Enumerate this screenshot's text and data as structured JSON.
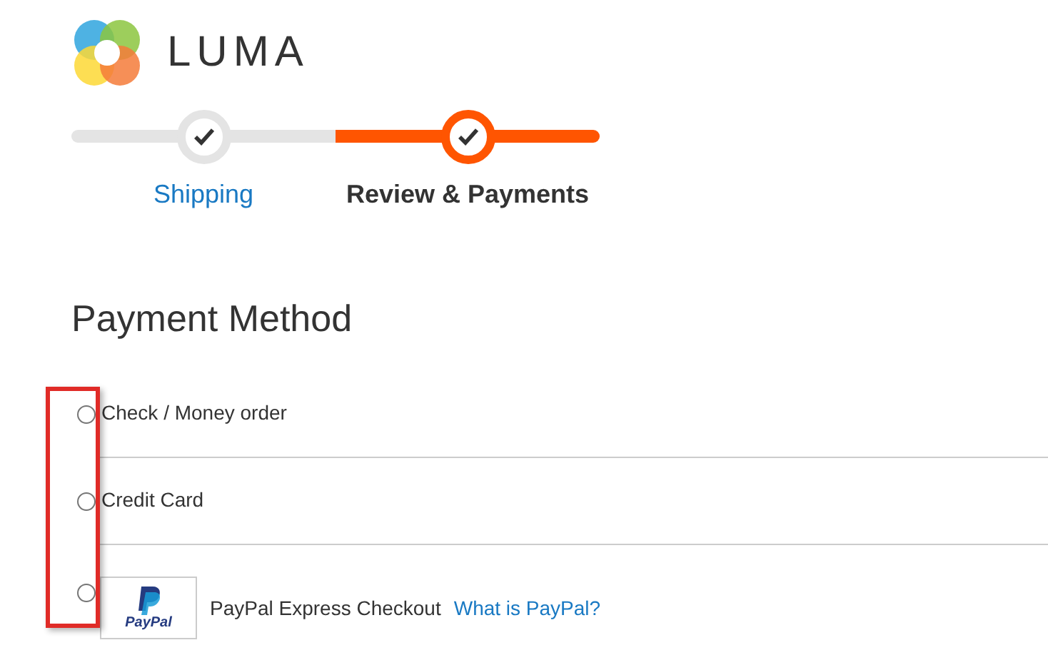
{
  "logo": {
    "text": "LUMA"
  },
  "steps": [
    {
      "label": "Shipping",
      "selected": false
    },
    {
      "label": "Review & Payments",
      "selected": true
    }
  ],
  "payment": {
    "title": "Payment Method",
    "methods": [
      {
        "kind": "plain",
        "label": "Check / Money order",
        "selected": false
      },
      {
        "kind": "plain",
        "label": "Credit Card",
        "selected": false
      },
      {
        "kind": "paypal",
        "logo_text": "PayPal",
        "label": "PayPal Express Checkout",
        "link": "What is PayPal?",
        "selected": false
      }
    ]
  }
}
